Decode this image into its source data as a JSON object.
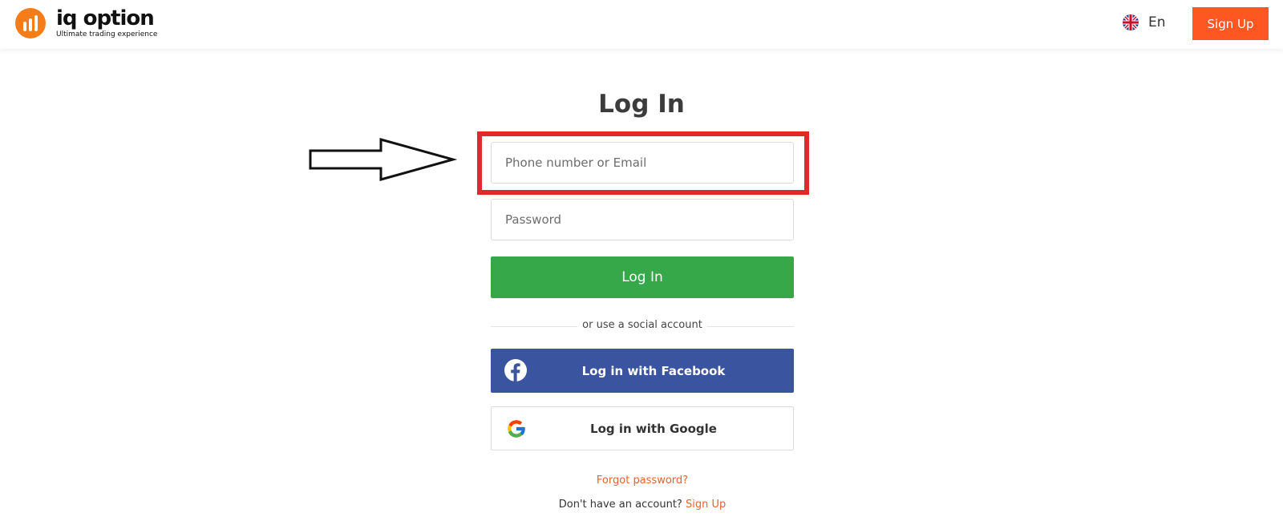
{
  "header": {
    "logo_name": "iq option",
    "logo_tagline": "Ultimate trading experience",
    "language": "En",
    "signup_label": "Sign Up"
  },
  "login": {
    "title": "Log In",
    "email_placeholder": "Phone number or Email",
    "password_placeholder": "Password",
    "submit_label": "Log In",
    "divider_text": "or use a social account",
    "facebook_label": "Log in with Facebook",
    "google_label": "Log in with Google",
    "forgot_label": "Forgot password?",
    "no_account_text": "Don't have an account?",
    "signup_link_label": "Sign Up"
  },
  "icons": [
    "logo-bars-icon",
    "uk-flag-icon",
    "arrow-right-icon",
    "facebook-icon",
    "google-icon"
  ],
  "colors": {
    "brand_orange": "#ff5722",
    "login_green": "#37a84a",
    "facebook_blue": "#3b54a0",
    "link_orange": "#e8622c",
    "highlight_red": "#e02a2a"
  }
}
